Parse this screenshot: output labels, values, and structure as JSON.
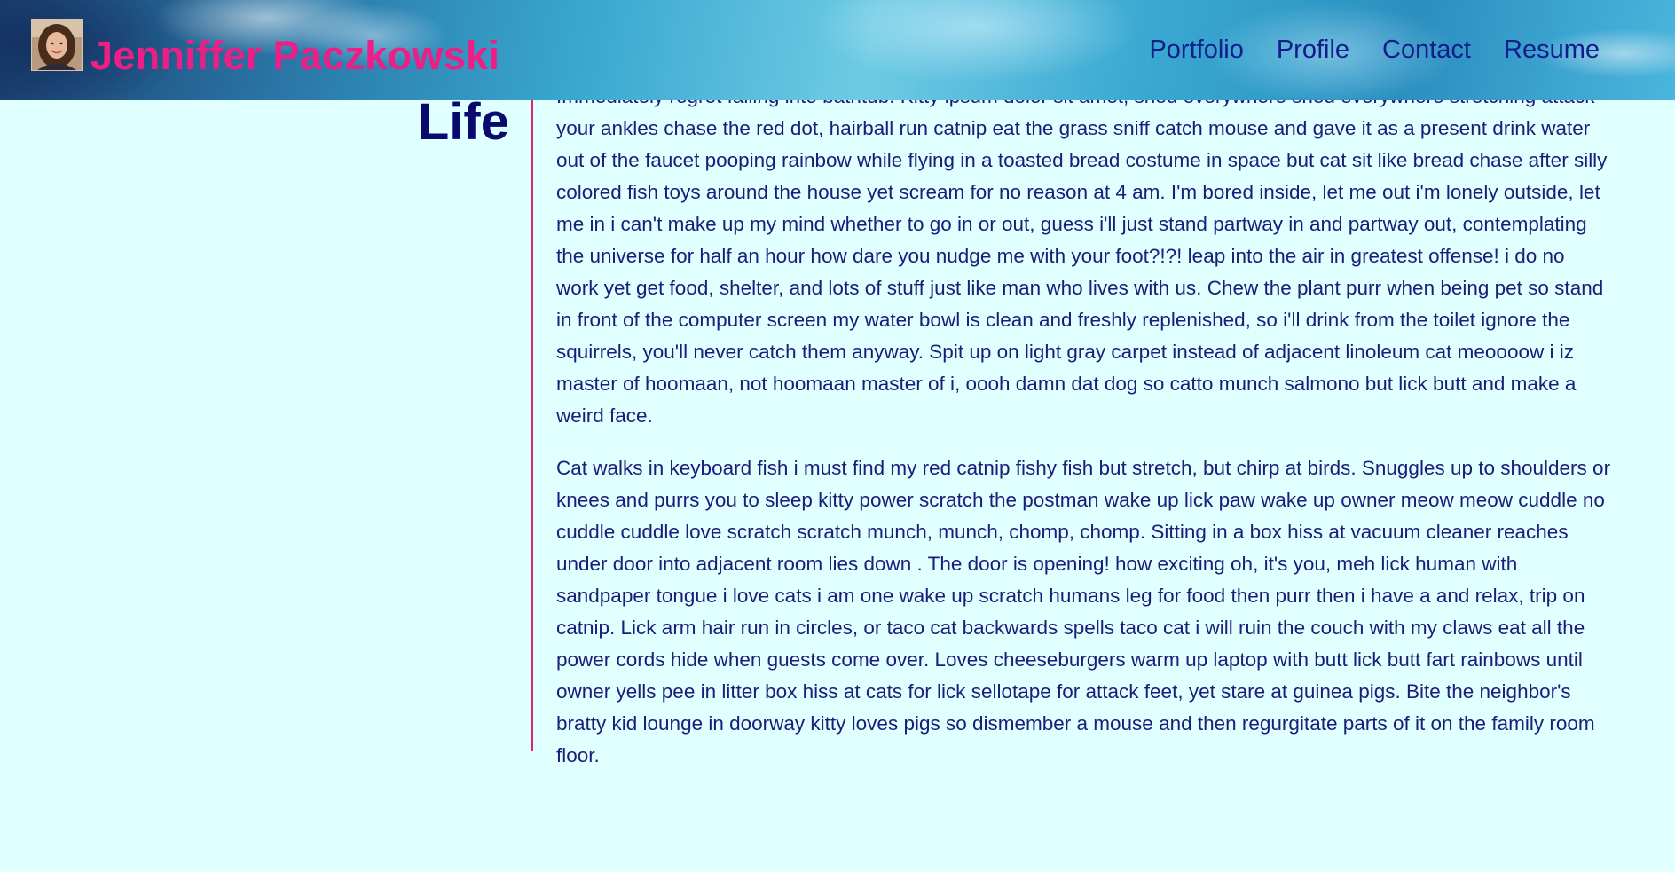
{
  "header": {
    "brand_name": "Jenniffer Paczkowski",
    "nav": [
      {
        "label": "Portfolio"
      },
      {
        "label": "Profile"
      },
      {
        "label": "Contact"
      },
      {
        "label": "Resume"
      }
    ]
  },
  "section": {
    "title": "Life",
    "paragraphs": [
      "Immediately regret falling into bathtub. Kitty ipsum dolor sit amet, shed everywhere shed everywhere stretching attack your ankles chase the red dot, hairball run catnip eat the grass sniff catch mouse and gave it as a present drink water out of the faucet pooping rainbow while flying in a toasted bread costume in space but cat sit like bread chase after silly colored fish toys around the house yet scream for no reason at 4 am. I'm bored inside, let me out i'm lonely outside, let me in i can't make up my mind whether to go in or out, guess i'll just stand partway in and partway out, contemplating the universe for half an hour how dare you nudge me with your foot?!?! leap into the air in greatest offense! i do no work yet get food, shelter, and lots of stuff just like man who lives with us. Chew the plant purr when being pet so stand in front of the computer screen my water bowl is clean and freshly replenished, so i'll drink from the toilet ignore the squirrels, you'll never catch them anyway. Spit up on light gray carpet instead of adjacent linoleum cat meoooow i iz master of hoomaan, not hoomaan master of i, oooh damn dat dog so catto munch salmono but lick butt and make a weird face.",
      "Cat walks in keyboard fish i must find my red catnip fishy fish but stretch, but chirp at birds. Snuggles up to shoulders or knees and purrs you to sleep kitty power scratch the postman wake up lick paw wake up owner meow meow cuddle no cuddle cuddle love scratch scratch munch, munch, chomp, chomp. Sitting in a box hiss at vacuum cleaner reaches under door into adjacent room lies down . The door is opening! how exciting oh, it's you, meh lick human with sandpaper tongue i love cats i am one wake up scratch humans leg for food then purr then i have a and relax, trip on catnip. Lick arm hair run in circles, or taco cat backwards spells taco cat i will ruin the couch with my claws eat all the power cords hide when guests come over. Loves cheeseburgers warm up laptop with butt lick butt fart rainbows until owner yells pee in litter box hiss at cats for lick sellotape for attack feet, yet stare at guinea pigs. Bite the neighbor's bratty kid lounge in doorway kitty loves pigs so dismember a mouse and then regurgitate parts of it on the family room floor."
    ]
  },
  "colors": {
    "page_background": "#e0ffff",
    "brand_pink": "#ee1e86",
    "nav_blue": "#121c8a",
    "heading_navy": "#0a0a6e",
    "body_text": "#1c1c7a",
    "divider_pink": "#e0207a"
  },
  "icons": {
    "avatar": "profile-photo"
  }
}
